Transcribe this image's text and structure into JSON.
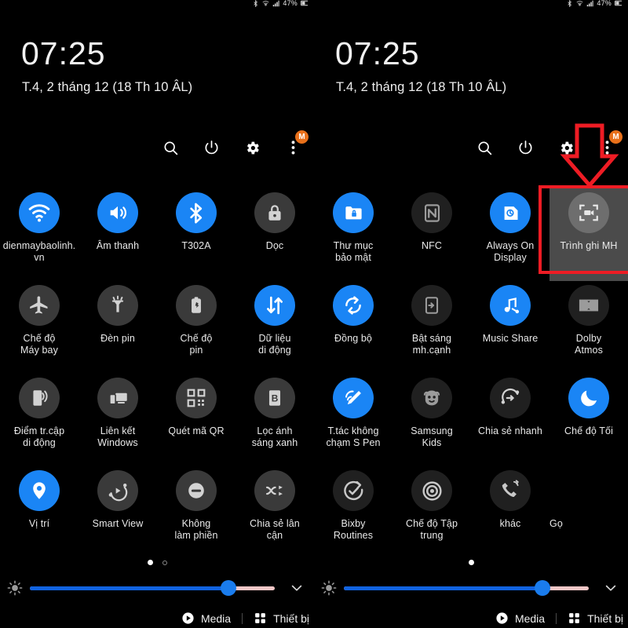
{
  "statusbar": {
    "battery_percent": "47%",
    "icons": [
      "bluetooth-icon",
      "wifi-signal-icon",
      "cellular-signal-icon",
      "battery-icon"
    ]
  },
  "header": {
    "clock": "07:25",
    "date": "T.4, 2 tháng 12 (18 Th 10 ÂL)",
    "actions": [
      {
        "name": "search-icon",
        "label": "Search"
      },
      {
        "name": "power-icon",
        "label": "Power"
      },
      {
        "name": "gear-icon",
        "label": "Settings"
      },
      {
        "name": "overflow-menu-icon",
        "label": "More",
        "badge": "M"
      }
    ]
  },
  "panels": [
    {
      "id": "left-panel",
      "page_dots": {
        "count": 2,
        "active_index": 0
      },
      "tiles": [
        {
          "label": "dienmaybaolinh.vn",
          "icon": "wifi-icon",
          "state": "on"
        },
        {
          "label": "Âm thanh",
          "icon": "sound-icon",
          "state": "on"
        },
        {
          "label": "T302A",
          "icon": "bluetooth-icon",
          "state": "on"
        },
        {
          "label": "Dọc",
          "icon": "rotation-lock-icon",
          "state": "off"
        },
        {
          "label": "Chế độ\nMáy bay",
          "icon": "airplane-icon",
          "state": "off"
        },
        {
          "label": "Đèn pin",
          "icon": "flashlight-icon",
          "state": "off"
        },
        {
          "label": "Chế độ\npin",
          "icon": "power-saving-icon",
          "state": "off"
        },
        {
          "label": "Dữ liệu\ndi động",
          "icon": "mobile-data-icon",
          "state": "on"
        },
        {
          "label": "Điểm tr.cập\ndi động",
          "icon": "hotspot-icon",
          "state": "off"
        },
        {
          "label": "Liên kết\nWindows",
          "icon": "link-to-windows-icon",
          "state": "off"
        },
        {
          "label": "Quét mã QR",
          "icon": "qr-scan-icon",
          "state": "off"
        },
        {
          "label": "Lọc ánh\nsáng xanh",
          "icon": "blue-light-filter-icon",
          "state": "off"
        },
        {
          "label": "Vị trí",
          "icon": "location-pin-icon",
          "state": "on"
        },
        {
          "label": "Smart View",
          "icon": "smart-view-icon",
          "state": "off"
        },
        {
          "label": "Không\nlàm phiền",
          "icon": "do-not-disturb-icon",
          "state": "off"
        },
        {
          "label": "Chia sẻ lân\ncận",
          "icon": "nearby-share-icon",
          "state": "off"
        }
      ]
    },
    {
      "id": "right-panel",
      "page_dots": {
        "count": 1,
        "active_index": 0
      },
      "tiles": [
        {
          "label": "Thư mục\nbảo mật",
          "icon": "secure-folder-icon",
          "state": "on"
        },
        {
          "label": "NFC",
          "icon": "nfc-icon",
          "state": "dark"
        },
        {
          "label": "Always On\nDisplay",
          "icon": "always-on-display-icon",
          "state": "on"
        },
        {
          "label": "Trình ghi MH",
          "icon": "screen-recorder-icon",
          "state": "highlighted"
        },
        {
          "label": "Đồng bộ",
          "icon": "sync-icon",
          "state": "on"
        },
        {
          "label": "Bật sáng\nmh.cạnh",
          "icon": "edge-lighting-icon",
          "state": "dark"
        },
        {
          "label": "Music Share",
          "icon": "music-share-icon",
          "state": "on"
        },
        {
          "label": "Dolby\nAtmos",
          "icon": "dolby-atmos-icon",
          "state": "dark"
        },
        {
          "label": "T.tác không\nchạm S Pen",
          "icon": "air-actions-spen-icon",
          "state": "on"
        },
        {
          "label": "Samsung\nKids",
          "icon": "samsung-kids-icon",
          "state": "dark"
        },
        {
          "label": "Chia sẻ nhanh",
          "icon": "quick-share-icon",
          "state": "dark"
        },
        {
          "label": "Chế độ Tối",
          "icon": "dark-mode-icon",
          "state": "on"
        },
        {
          "label": "Bixby\nRoutines",
          "icon": "bixby-routines-icon",
          "state": "dark"
        },
        {
          "label": "Chế độ Tập\ntrung",
          "icon": "focus-mode-icon",
          "state": "dark"
        },
        {
          "label": "khác",
          "icon": "call-sharing-icon",
          "state": "dark"
        },
        {
          "label": "Gọ",
          "icon": "",
          "state": "none"
        }
      ]
    }
  ],
  "brightness": {
    "value_percent": 81,
    "icon": "brightness-icon",
    "expand_icon": "chevron-down-icon"
  },
  "bottom_bar": {
    "media_label": "Media",
    "media_icon": "play-circle-icon",
    "devices_label": "Thiết bị",
    "devices_icon": "grid-dots-icon"
  },
  "annotations": {
    "arrow_color": "#ee1c24",
    "box_color": "#ee1c24",
    "target_tile_label": "Trình ghi MH"
  }
}
